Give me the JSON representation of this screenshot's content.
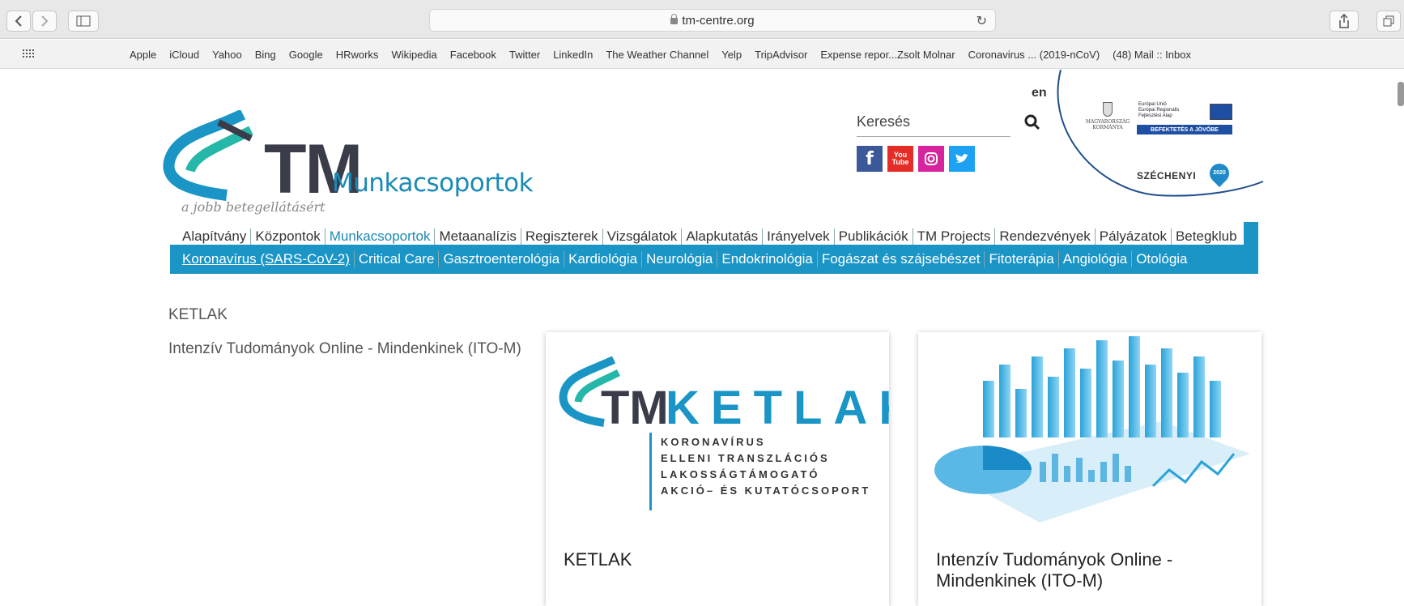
{
  "browser": {
    "url": "tm-centre.org",
    "bookmarks": [
      "Apple",
      "iCloud",
      "Yahoo",
      "Bing",
      "Google",
      "HRworks",
      "Wikipedia",
      "Facebook",
      "Twitter",
      "LinkedIn",
      "The Weather Channel",
      "Yelp",
      "TripAdvisor",
      "Expense repor...Zsolt Molnar",
      "Coronavirus ... (2019-nCoV)",
      "(48) Mail :: Inbox"
    ]
  },
  "header": {
    "logo_main": "TM",
    "logo_sub": "Munkacsoportok",
    "tagline": "a jobb betegellátásért",
    "lang": "en",
    "search_label": "Keresés",
    "eu_text": "Európai Unió\nEurópai Regionális\nFejlesztési Alap",
    "eu_button": "BEFEKTETÉS A JÖVŐBE",
    "hungary_text": "MAGYARORSZÁG\nKORMÁNYA",
    "szechenyi": "SZÉCHENYI",
    "szechenyi_year": "2020",
    "youtube": "You\nTube"
  },
  "nav": {
    "primary": [
      "Alapítvány",
      "Központok",
      "Munkacsoportok",
      "Metaanalízis",
      "Regiszterek",
      "Vizsgálatok",
      "Alapkutatás",
      "Irányelvek",
      "Publikációk",
      "TM Projects",
      "Rendezvények",
      "Pályázatok",
      "Betegklub"
    ],
    "secondary": [
      "Koronavírus (SARS-CoV-2)",
      "Critical Care",
      "Gasztroenterológia",
      "Kardiológia",
      "Neurológia",
      "Endokrinológia",
      "Fogászat és szájsebészet",
      "Fitoterápia",
      "Angiológia",
      "Otológia"
    ]
  },
  "main": {
    "left_links": [
      "KETLAK",
      "Intenzív Tudományok Online - Mindenkinek (ITO-M)"
    ],
    "cards": [
      {
        "title": "KETLAK",
        "logo_tm": "TM",
        "logo_word": "KETLAK",
        "logo_lines": [
          "KORONAVÍRUS",
          "ELLENI TRANSZLÁCIÓS",
          "LAKOSSÁGTÁMOGATÓ",
          "AKCIÓ– ÉS KUTATÓCSOPORT"
        ]
      },
      {
        "title": "Intenzív Tudományok Online - Mindenkinek (ITO-M)"
      }
    ]
  },
  "colors": {
    "accent": "#1a95c6",
    "dark": "#3a3d49"
  }
}
